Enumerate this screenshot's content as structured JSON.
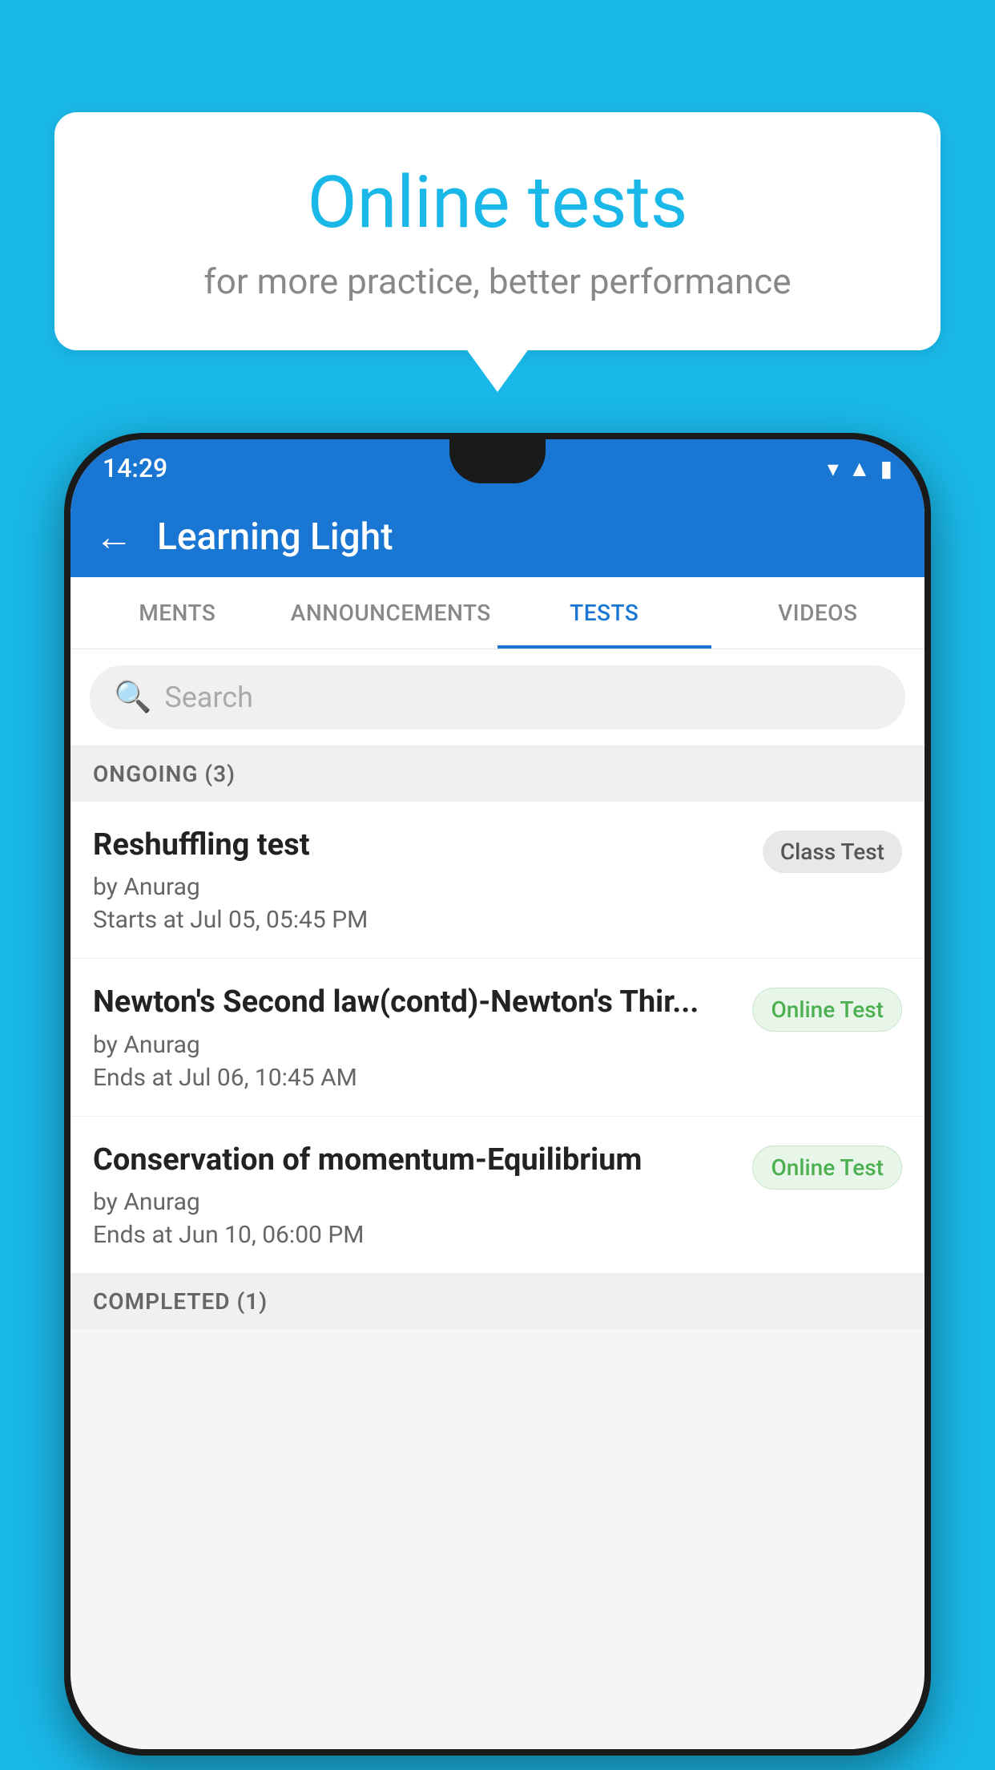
{
  "background": {
    "color": "#1ab8e8"
  },
  "speech_bubble": {
    "title": "Online tests",
    "subtitle": "for more practice, better performance"
  },
  "phone": {
    "status_bar": {
      "time": "14:29",
      "icons": [
        "wifi",
        "signal",
        "battery"
      ]
    },
    "app_bar": {
      "title": "Learning Light",
      "back_label": "←"
    },
    "tabs": [
      {
        "label": "MENTS",
        "active": false
      },
      {
        "label": "ANNOUNCEMENTS",
        "active": false
      },
      {
        "label": "TESTS",
        "active": true
      },
      {
        "label": "VIDEOS",
        "active": false
      }
    ],
    "search": {
      "placeholder": "Search",
      "icon": "🔍"
    },
    "sections": [
      {
        "header": "ONGOING (3)",
        "items": [
          {
            "name": "Reshuffling test",
            "author": "by Anurag",
            "date": "Starts at  Jul 05, 05:45 PM",
            "badge": "Class Test",
            "badge_type": "class"
          },
          {
            "name": "Newton's Second law(contd)-Newton's Thir...",
            "author": "by Anurag",
            "date": "Ends at  Jul 06, 10:45 AM",
            "badge": "Online Test",
            "badge_type": "online"
          },
          {
            "name": "Conservation of momentum-Equilibrium",
            "author": "by Anurag",
            "date": "Ends at  Jun 10, 06:00 PM",
            "badge": "Online Test",
            "badge_type": "online"
          }
        ]
      }
    ],
    "completed_header": "COMPLETED (1)"
  }
}
